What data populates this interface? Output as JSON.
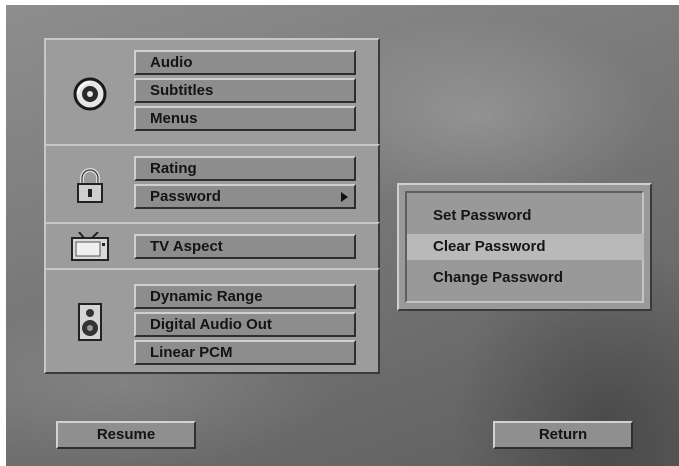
{
  "setup_menu": {
    "sections": [
      {
        "icon": "disc-icon",
        "items": [
          "Audio",
          "Subtitles",
          "Menus"
        ]
      },
      {
        "icon": "padlock-icon",
        "items": [
          "Rating",
          "Password"
        ]
      },
      {
        "icon": "tv-icon",
        "items": [
          "TV Aspect"
        ]
      },
      {
        "icon": "speaker-icon",
        "items": [
          "Dynamic Range",
          "Digital Audio Out",
          "Linear PCM"
        ]
      }
    ]
  },
  "password_submenu": {
    "items": [
      "Set Password",
      "Clear Password",
      "Change Password"
    ],
    "selected": "Clear Password"
  },
  "footer": {
    "resume_label": "Resume",
    "return_label": "Return"
  }
}
